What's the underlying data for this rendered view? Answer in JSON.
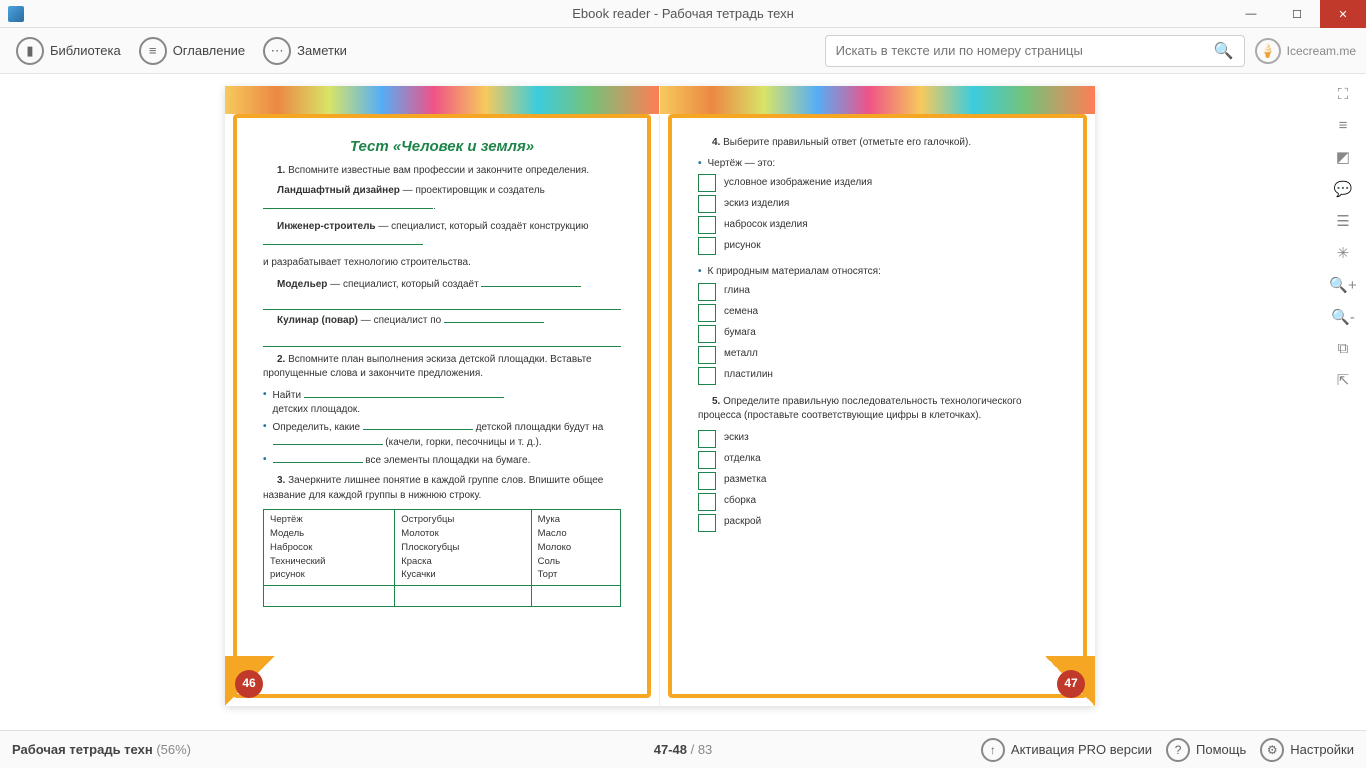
{
  "window": {
    "title": "Ebook reader - Рабочая тетрадь техн"
  },
  "toolbar": {
    "library": "Библиотека",
    "contents": "Оглавление",
    "notes": "Заметки",
    "search_placeholder": "Искать в тексте или по номеру страницы",
    "brand": "Icecream.me"
  },
  "left_page": {
    "number": "46",
    "title": "Тест «Человек и земля»",
    "q1_intro": "1. Вспомните известные вам профессии и закончите определения.",
    "q1_a_label": "Ландшафтный дизайнер",
    "q1_a_text": "— проектировщик и созда­тель",
    "q1_b_label": "Инженер-строитель",
    "q1_b_text": "— специалист, который создаёт конструкцию",
    "q1_b_text2": "и разрабатывает технологию строительства.",
    "q1_c_label": "Модельер",
    "q1_c_text": "— специалист, который создаёт",
    "q1_d_label": "Кулинар (повар)",
    "q1_d_text": "— специалист по",
    "q2_intro": "2. Вспомните план выполнения эскиза детской пло­щадки. Вставьте пропущенные слова и закончите пред­ложения.",
    "q2_b1a": "Найти",
    "q2_b1b": "детских площадок.",
    "q2_b2a": "Определить, какие",
    "q2_b2b": "детской площадки будут на",
    "q2_b2c": "(качели, горки, песочницы и т. д.).",
    "q2_b3": "все элементы площадки на бумаге.",
    "q3_intro": "3. Зачеркните лишнее понятие в каждой группе слов. Впишите общее название для каждой группы в нижнюю строку.",
    "table": {
      "col1": [
        "Чертёж",
        "Модель",
        "Набросок",
        "Технический",
        "рисунок"
      ],
      "col2": [
        "Острогубцы",
        "Молоток",
        "Плоскогубцы",
        "Краска",
        "Кусачки"
      ],
      "col3": [
        "Мука",
        "Масло",
        "Молоко",
        "Соль",
        "Торт"
      ]
    }
  },
  "right_page": {
    "number": "47",
    "q4_intro": "4. Выберите правильный ответ (отметьте его галочкой).",
    "q4_a_head": "Чертёж — это:",
    "q4_a_opts": [
      "условное изображение изделия",
      "эскиз изделия",
      "набросок изделия",
      "рисунок"
    ],
    "q4_b_head": "К природным материалам относятся:",
    "q4_b_opts": [
      "глина",
      "семена",
      "бумага",
      "металл",
      "пластилин"
    ],
    "q5_intro": "5. Определите правильную последовательность тех­нологического процесса (проставьте соответствующие цифры в клеточках).",
    "q5_opts": [
      "эскиз",
      "отделка",
      "разметка",
      "сборка",
      "раскрой"
    ]
  },
  "status": {
    "title": "Рабочая тетрадь техн",
    "progress": "(56%)",
    "pages": "47-48",
    "total": "/ 83",
    "activation": "Активация PRO версии",
    "help": "Помощь",
    "settings": "Настройки"
  }
}
